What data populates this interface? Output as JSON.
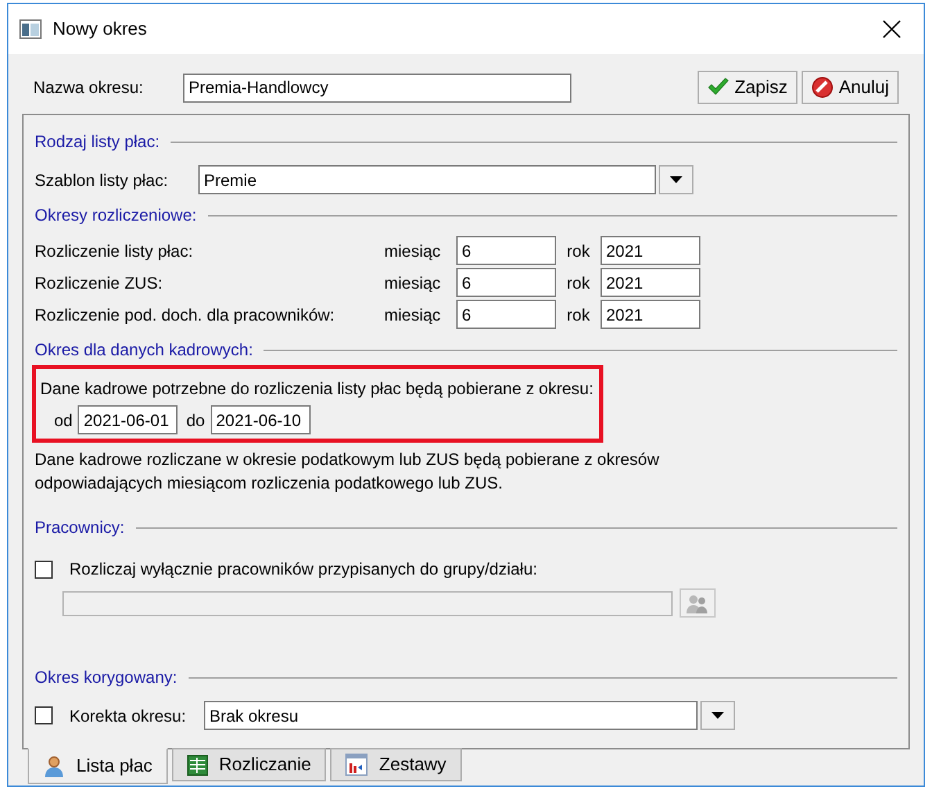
{
  "window": {
    "title": "Nowy okres"
  },
  "name_field": {
    "label": "Nazwa okresu:",
    "value": "Premia-Handlowcy"
  },
  "buttons": [
    {
      "label": "Zapisz",
      "kind": "save"
    },
    {
      "label": "Anuluj",
      "kind": "cancel"
    }
  ],
  "payroll_type": {
    "heading": "Rodzaj listy płac:",
    "label": "Szablon listy płac:",
    "value": "Premie"
  },
  "settlement_periods": {
    "heading": "Okresy rozliczeniowe:",
    "rows": [
      {
        "label": "Rozliczenie listy płac:",
        "month_label": "miesiąc",
        "month": "6",
        "year_label": "rok",
        "year": "2021"
      },
      {
        "label": "Rozliczenie ZUS:",
        "month_label": "miesiąc",
        "month": "6",
        "year_label": "rok",
        "year": "2021"
      },
      {
        "label": "Rozliczenie pod. doch. dla pracowników:",
        "month_label": "miesiąc",
        "month": "6",
        "year_label": "rok",
        "year": "2021"
      }
    ]
  },
  "hr_period": {
    "heading": "Okres dla danych kadrowych:",
    "intro": "Dane kadrowe potrzebne do rozliczenia listy płac będą pobierane z okresu:",
    "from_label": "od",
    "from": "2021-06-01",
    "to_label": "do",
    "to": "2021-06-10",
    "note": "Dane kadrowe rozliczane w okresie podatkowym lub ZUS będą pobierane z okresów odpowiadających miesiącom rozliczenia podatkowego lub ZUS."
  },
  "employees": {
    "heading": "Pracownicy:",
    "checkbox_label": "Rozliczaj wyłącznie pracowników przypisanych do grupy/działu:",
    "checked": false
  },
  "correction": {
    "heading": "Okres korygowany:",
    "checkbox_label": "Korekta okresu:",
    "checked": false,
    "value": "Brak okresu"
  },
  "tabs": [
    {
      "label": "Lista płac",
      "kind": "person",
      "selected": true
    },
    {
      "label": "Rozliczanie",
      "kind": "sheet",
      "selected": false
    },
    {
      "label": "Zestawy",
      "kind": "chart",
      "selected": false
    }
  ]
}
